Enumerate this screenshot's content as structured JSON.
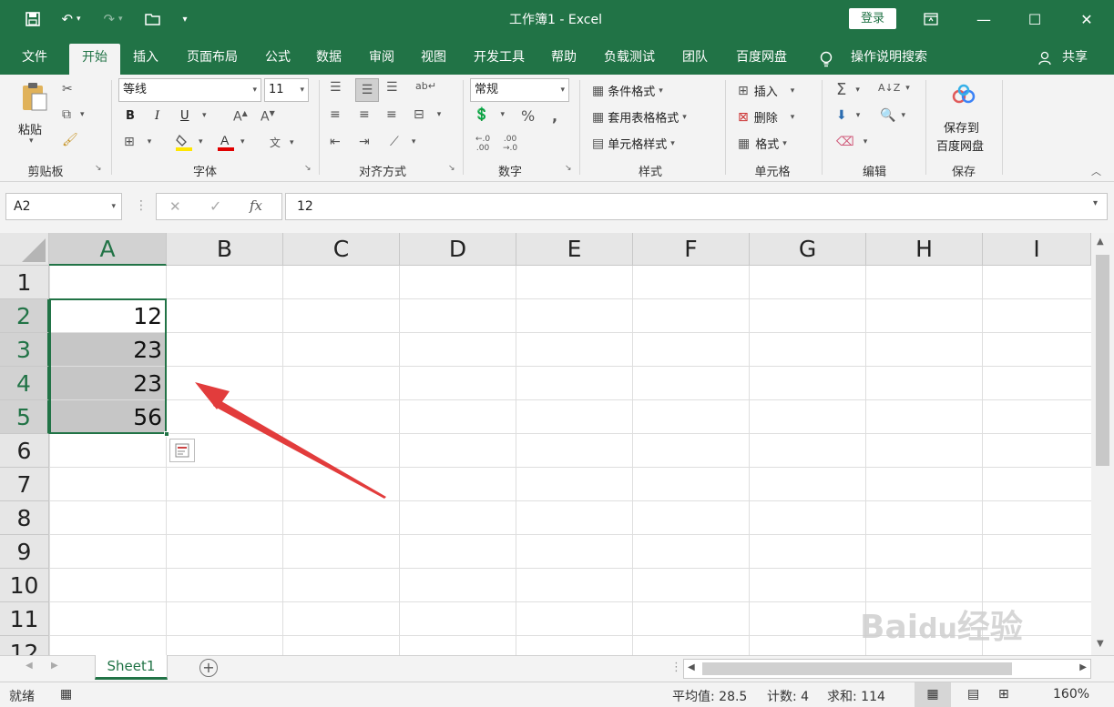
{
  "window": {
    "title": "工作簿1 - Excel",
    "login_label": "登录"
  },
  "tabs": [
    "文件",
    "开始",
    "插入",
    "页面布局",
    "公式",
    "数据",
    "审阅",
    "视图",
    "开发工具",
    "帮助",
    "负载测试",
    "团队",
    "百度网盘"
  ],
  "active_tab": "开始",
  "tell_me": "操作说明搜索",
  "share_label": "共享",
  "ribbon": {
    "clipboard": {
      "paste": "粘贴",
      "label": "剪贴板"
    },
    "font": {
      "name": "等线",
      "size": "11",
      "bold": "B",
      "italic": "I",
      "underline": "U",
      "label": "字体"
    },
    "alignment": {
      "label": "对齐方式"
    },
    "number": {
      "format": "常规",
      "label": "数字"
    },
    "styles": {
      "conditional": "条件格式",
      "table": "套用表格格式",
      "cell": "单元格样式",
      "label": "样式"
    },
    "cells": {
      "insert": "插入",
      "delete": "删除",
      "format": "格式",
      "label": "单元格"
    },
    "editing": {
      "label": "编辑"
    },
    "save": {
      "line1": "保存到",
      "line2": "百度网盘",
      "label": "保存"
    }
  },
  "formula_bar": {
    "name_box": "A2",
    "fx": "fx",
    "value": "12"
  },
  "grid": {
    "columns": [
      "A",
      "B",
      "C",
      "D",
      "E",
      "F",
      "G",
      "H",
      "I"
    ],
    "rows": [
      "1",
      "2",
      "3",
      "4",
      "5",
      "6",
      "7",
      "8",
      "9",
      "10",
      "11",
      "12"
    ],
    "cells": {
      "A2": "12",
      "A3": "23",
      "A4": "23",
      "A5": "56"
    }
  },
  "sheet_tab": "Sheet1",
  "status": {
    "ready": "就绪",
    "average": "平均值: 28.5",
    "count": "计数: 4",
    "sum": "求和: 114",
    "zoom": "160%"
  },
  "colors": {
    "accent": "#217346",
    "arrow": "#e23c3c"
  },
  "watermark": "Baidu经验 jingyan.baidu.com"
}
